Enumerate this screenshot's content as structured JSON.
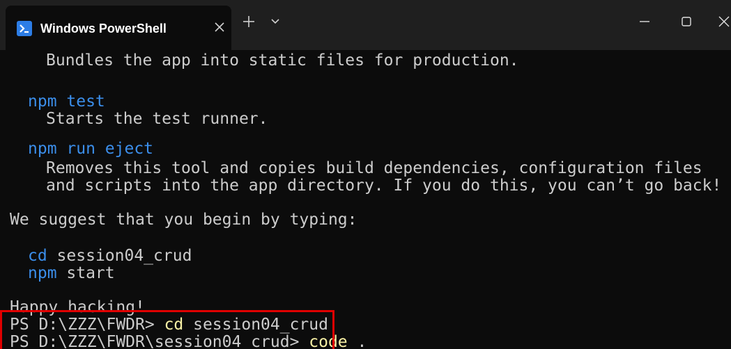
{
  "window": {
    "tab_title": "Windows PowerShell",
    "tab_icon": "powershell-icon",
    "close_tab_icon": "close-icon",
    "new_tab_icon": "plus-icon",
    "dropdown_icon": "chevron-down-icon",
    "minimize_icon": "minimize-icon",
    "maximize_icon": "maximize-icon",
    "close_window_icon": "close-icon"
  },
  "terminal": {
    "lines": {
      "l0": "Bundles the app into static files for production.",
      "l1_cmd": "npm test",
      "l2": "Starts the test runner.",
      "l3_cmd": "npm run eject",
      "l4": "Removes this tool and copies build dependencies, configuration files",
      "l5": "and scripts into the app directory. If you do this, you can’t go back!",
      "l6": "We suggest that you begin by typing:",
      "l7_cd": "cd",
      "l7_arg": " session04_crud",
      "l8_npm": "npm",
      "l8_arg": " start",
      "l9": "Happy hacking!",
      "p1_prompt": "PS D:\\ZZZ\\FWDR> ",
      "p1_cmd": "cd",
      "p1_arg": " session04_crud",
      "p2_prompt": "PS D:\\ZZZ\\FWDR\\session04_crud> ",
      "p2_cmd": "code",
      "p2_arg": " ."
    }
  },
  "colors": {
    "background": "#0c0c0c",
    "titlebar": "#1f1f1f",
    "text": "#cccccc",
    "command_blue": "#3b8eea",
    "command_yellow": "#f9f1a5",
    "highlight_red": "#e00000",
    "accent": "#2c7de6"
  }
}
